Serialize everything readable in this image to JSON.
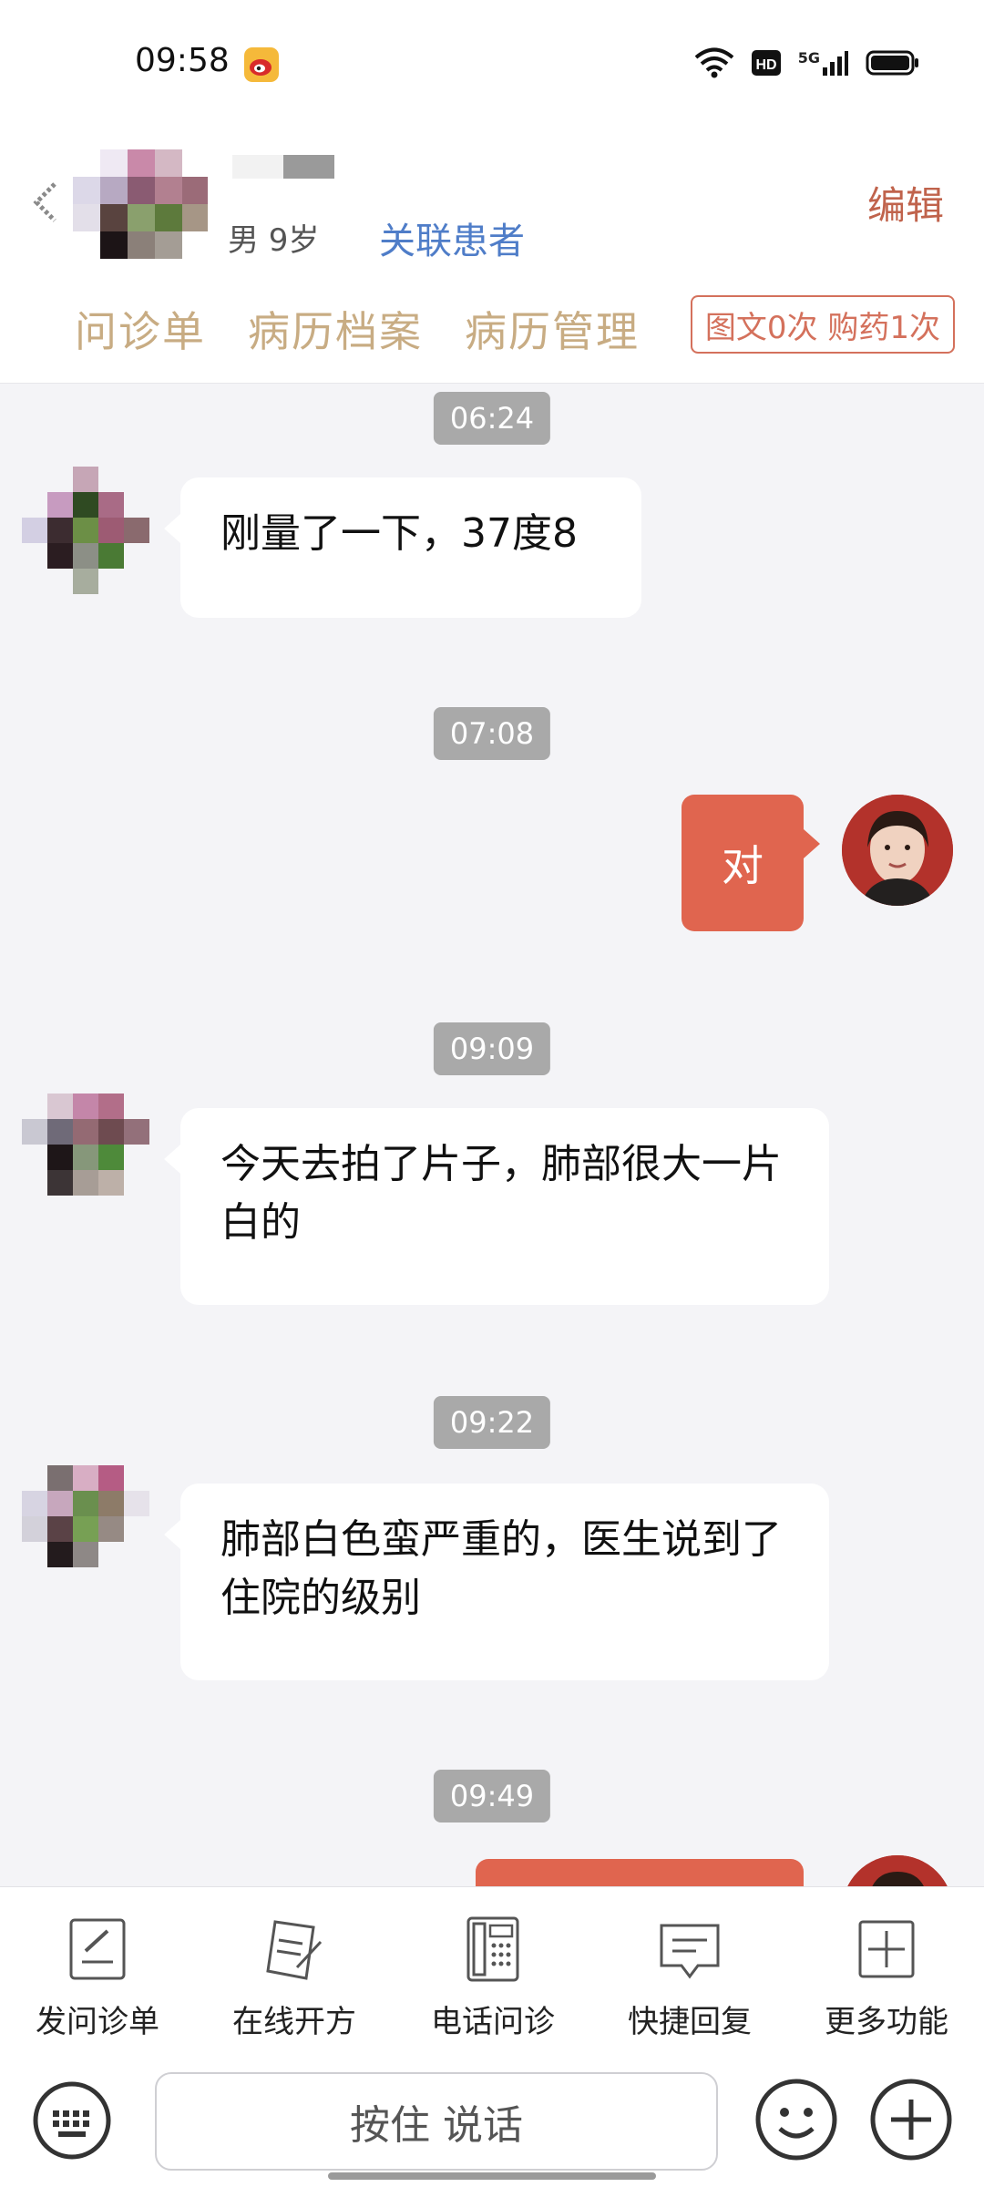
{
  "status_bar": {
    "time": "09:58",
    "network": "5G"
  },
  "header": {
    "patient_meta": "男 9岁",
    "link_patient": "关联患者",
    "edit": "编辑",
    "tabs": [
      "问诊单",
      "病历档案",
      "病历管理"
    ],
    "quota": "图文0次 购药1次"
  },
  "chat": {
    "timestamps": [
      "06:24",
      "07:08",
      "09:09",
      "09:22",
      "09:49"
    ],
    "messages": [
      {
        "from": "patient",
        "text": "刚量了一下，37度8"
      },
      {
        "from": "doctor",
        "text": "对"
      },
      {
        "from": "patient",
        "text": "今天去拍了片子，肺部很大一片白的"
      },
      {
        "from": "patient",
        "text": "肺部白色蛮严重的，医生说到了住院的级别"
      }
    ]
  },
  "toolbar": {
    "items": [
      {
        "label": "发问诊单",
        "icon": "form-icon"
      },
      {
        "label": "在线开方",
        "icon": "prescription-icon"
      },
      {
        "label": "电话问诊",
        "icon": "phone-icon"
      },
      {
        "label": "快捷回复",
        "icon": "quick-reply-icon"
      },
      {
        "label": "更多功能",
        "icon": "more-icon"
      }
    ]
  },
  "input": {
    "hold_to_talk": "按住 说话"
  },
  "colors": {
    "accent": "#e0654f",
    "tab": "#c8ac83",
    "link": "#4f7dc8"
  }
}
